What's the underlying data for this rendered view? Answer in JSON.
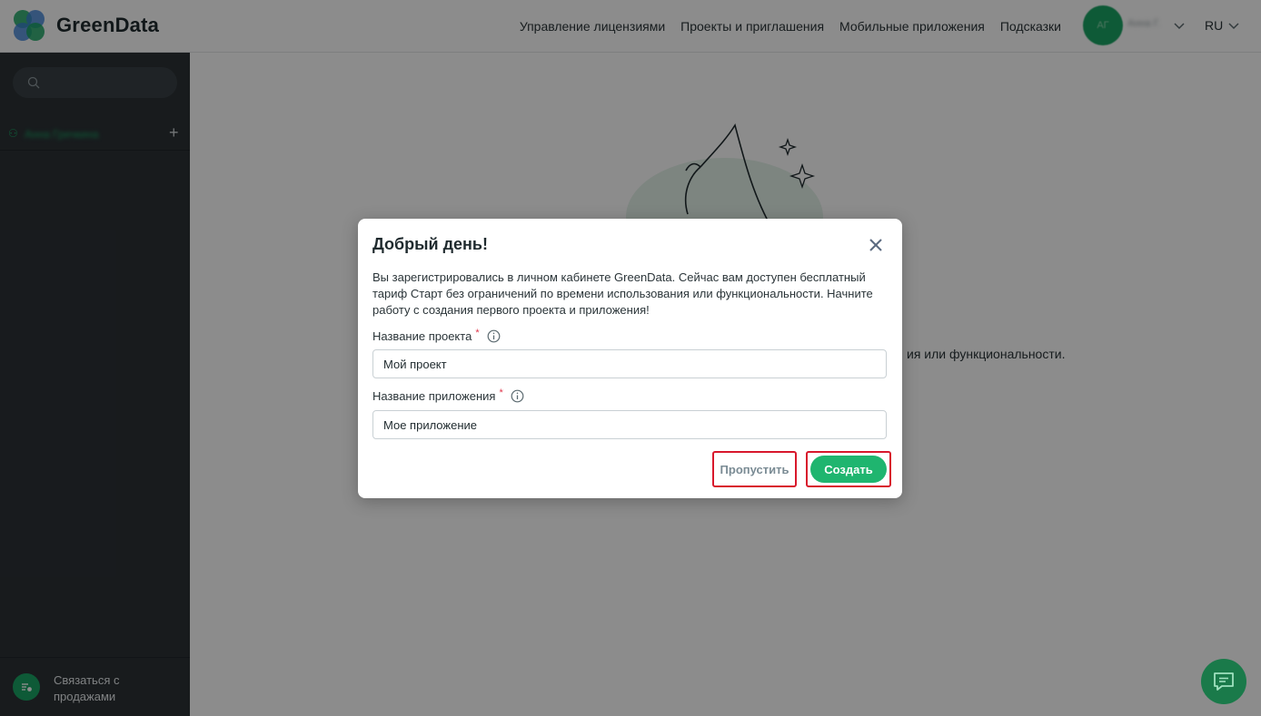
{
  "header": {
    "brand": "GreenData",
    "nav": [
      "Управление лицензиями",
      "Проекты и приглашения",
      "Мобильные приложения",
      "Подсказки"
    ],
    "avatar_initials": "АГ",
    "user_name": "Анна Г.",
    "language": "RU"
  },
  "sidebar": {
    "org_name": "Анна Гречкина",
    "sales_label": "Связаться с продажами"
  },
  "main": {
    "background_text": "ия или функциональности."
  },
  "modal": {
    "title": "Добрый день!",
    "description": "Вы зарегистрировались в личном кабинете GreenData. Сейчас вам доступен бесплатный тариф Старт без ограничений по времени использования или функциональности. Начните работу с создания первого проекта и приложения!",
    "project_label": "Название проекта",
    "project_value": "Мой проект",
    "app_label": "Название приложения",
    "app_value": "Мое приложение",
    "required_mark": "*",
    "skip_label": "Пропустить",
    "create_label": "Создать"
  },
  "colors": {
    "accent": "#1fb56f",
    "sidebar_bg": "#2c3236",
    "highlight": "#d8182c"
  }
}
